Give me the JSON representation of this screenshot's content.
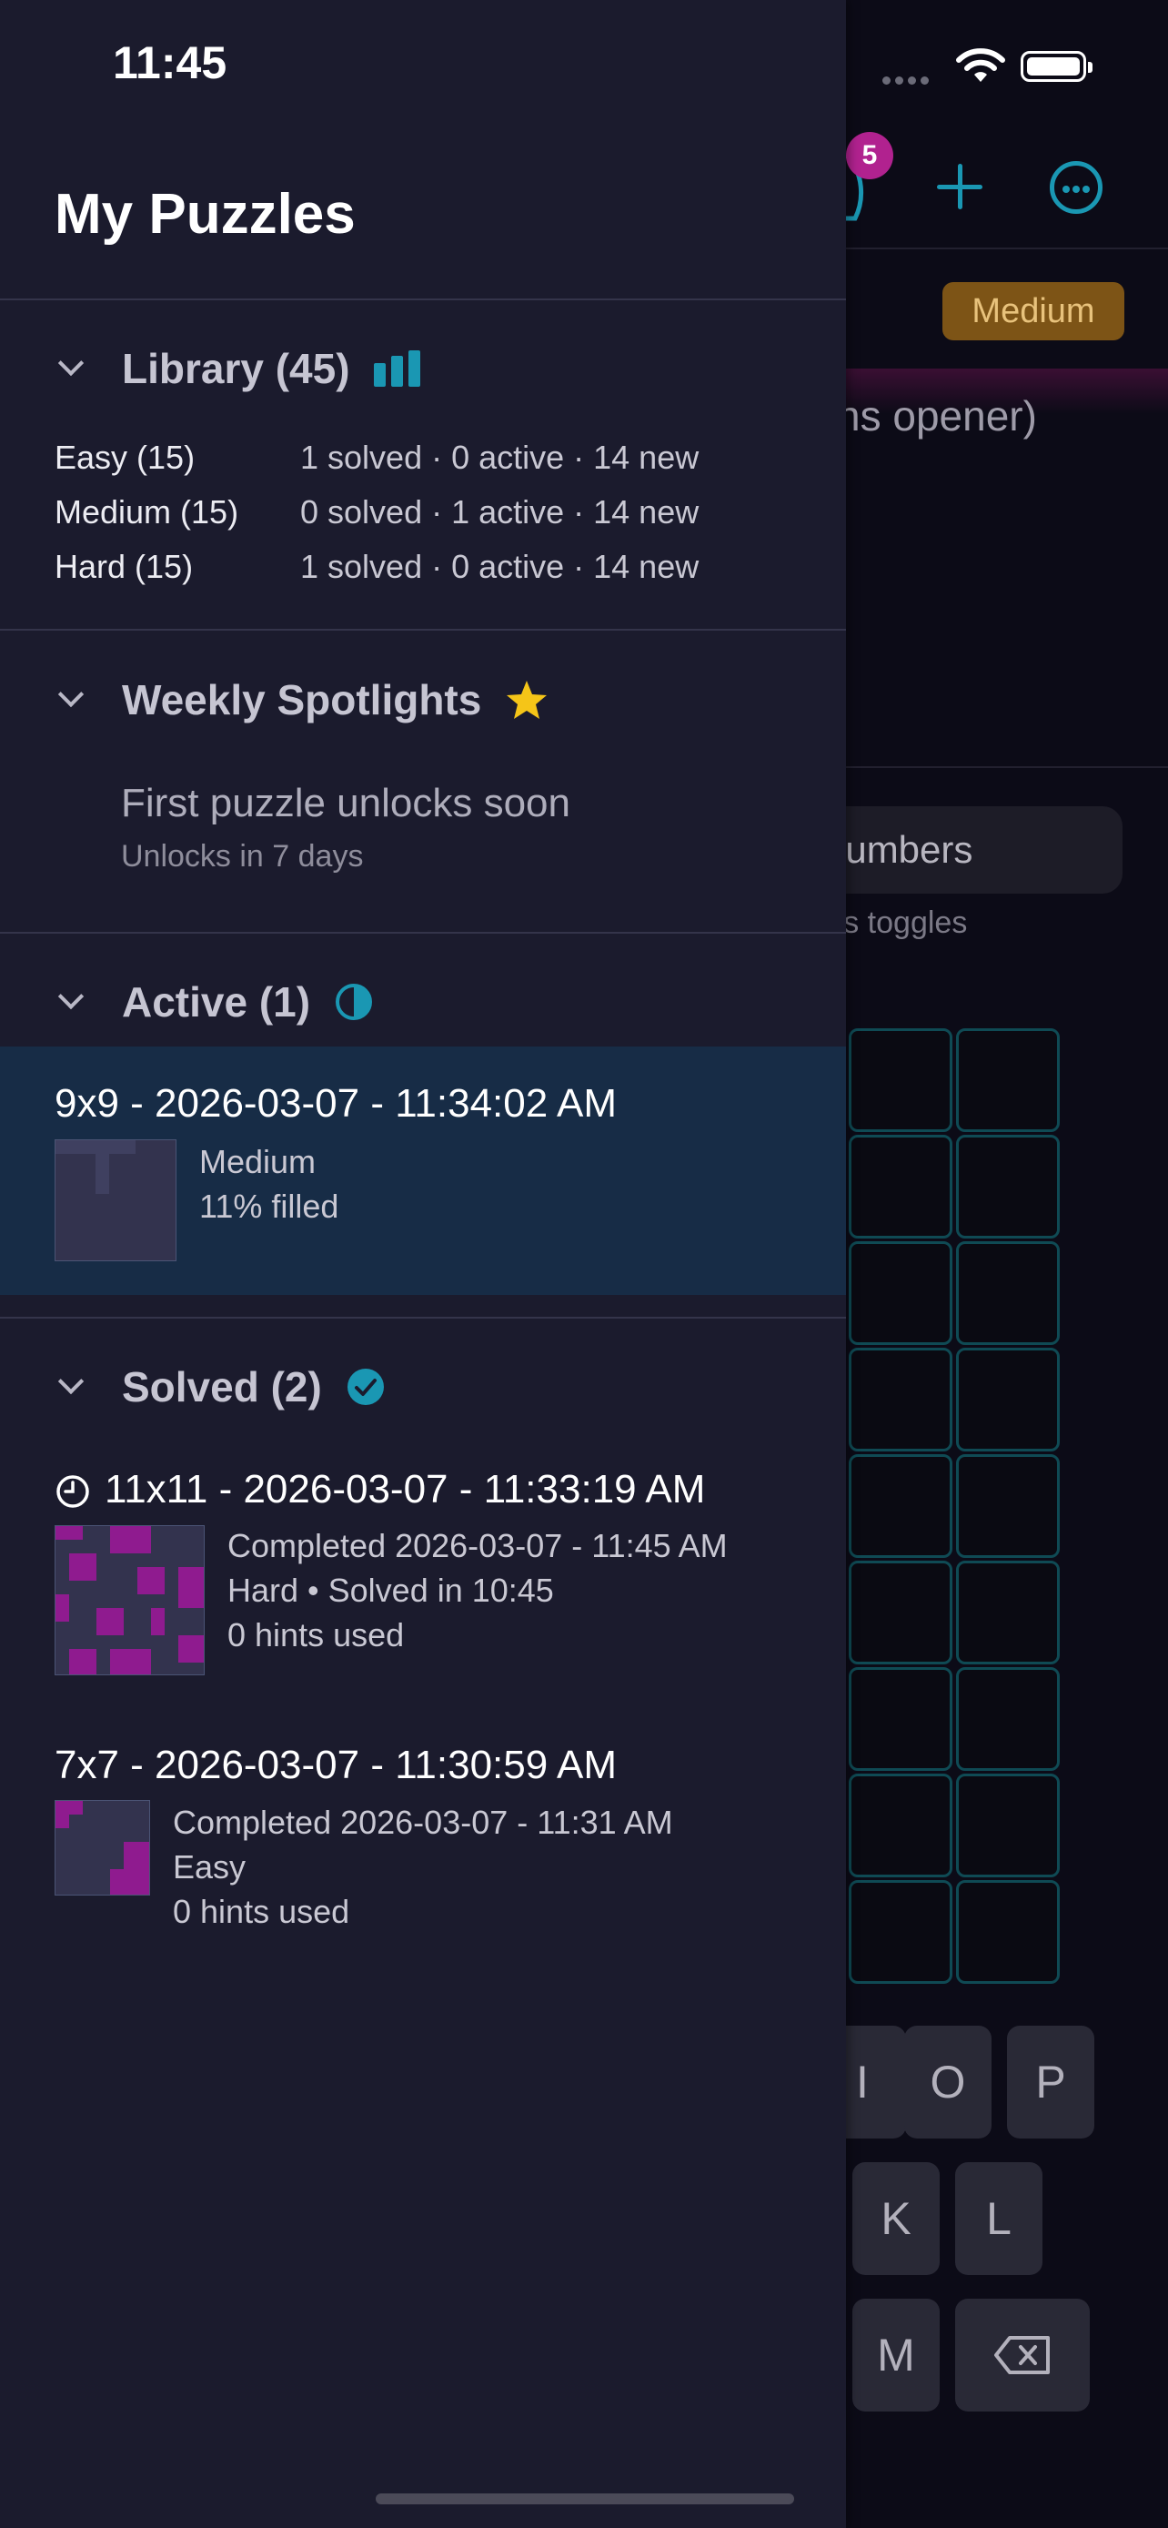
{
  "status_bar": {
    "time": "11:45"
  },
  "background_app": {
    "badge_count": "5",
    "difficulty_pill": "Medium",
    "puzzle_name_fragment": "ns opener)",
    "numbers_toggle_label": "lumbers",
    "toggle_hint": "ress toggles",
    "keys": [
      "I",
      "O",
      "P",
      "K",
      "L",
      "M"
    ]
  },
  "drawer": {
    "title": "My Puzzles",
    "library": {
      "header": "Library (45)",
      "rows": [
        {
          "label": "Easy (15)",
          "stats": "1 solved · 0 active · 14 new"
        },
        {
          "label": "Medium (15)",
          "stats": "0 solved · 1 active · 14 new"
        },
        {
          "label": "Hard (15)",
          "stats": "1 solved · 0 active · 14 new"
        }
      ]
    },
    "spotlights": {
      "header": "Weekly Spotlights",
      "message": "First puzzle unlocks soon",
      "sub": "Unlocks in 7 days"
    },
    "active": {
      "header": "Active (1)",
      "items": [
        {
          "title": "9x9 - 2026-03-07 - 11:34:02 AM",
          "difficulty": "Medium",
          "progress": "11% filled"
        }
      ]
    },
    "solved": {
      "header": "Solved (2)",
      "items": [
        {
          "title": "11x11 - 2026-03-07 - 11:33:19 AM",
          "completed": "Completed 2026-03-07 - 11:45 AM",
          "detail": "Hard • Solved in 10:45",
          "hints": "0 hints used"
        },
        {
          "title": "7x7 - 2026-03-07 - 11:30:59 AM",
          "completed": "Completed 2026-03-07 - 11:31 AM",
          "detail": "Easy",
          "hints": "0 hints used"
        }
      ]
    }
  },
  "colors": {
    "accent": "#1a97b3",
    "star": "#f5c518",
    "magenta": "#8f1b8f",
    "drawer_bg": "#1b1b2d",
    "active_bg": "#172c46"
  }
}
